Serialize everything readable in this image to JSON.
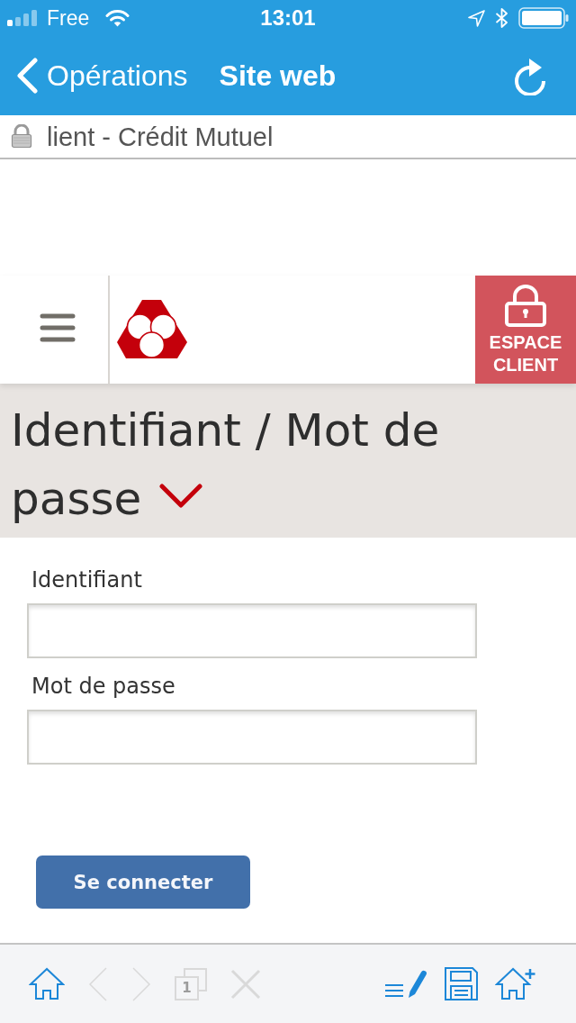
{
  "status_bar": {
    "carrier": "Free",
    "time": "13:01"
  },
  "nav_bar": {
    "back_label": "Opérations",
    "title": "Site web"
  },
  "url_bar": {
    "page_title": "lient - Crédit Mutuel"
  },
  "site_header": {
    "account_button": "ESPACE CLIENT"
  },
  "login_section": {
    "heading": "Identifiant / Mot de passe",
    "fields": [
      {
        "label": "Identifiant"
      },
      {
        "label": "Mot de passe"
      }
    ],
    "submit_button": "Se connecter"
  },
  "toolbar": {
    "left": [
      {
        "kind": "home",
        "disabled": false
      },
      {
        "kind": "back",
        "disabled": true
      },
      {
        "kind": "forward",
        "disabled": true
      },
      {
        "kind": "tabs",
        "disabled": true,
        "count": "1"
      },
      {
        "kind": "close",
        "disabled": true
      }
    ],
    "right": [
      {
        "kind": "edit_list",
        "disabled": false
      },
      {
        "kind": "save",
        "disabled": false
      },
      {
        "kind": "add_home",
        "disabled": false
      }
    ]
  }
}
